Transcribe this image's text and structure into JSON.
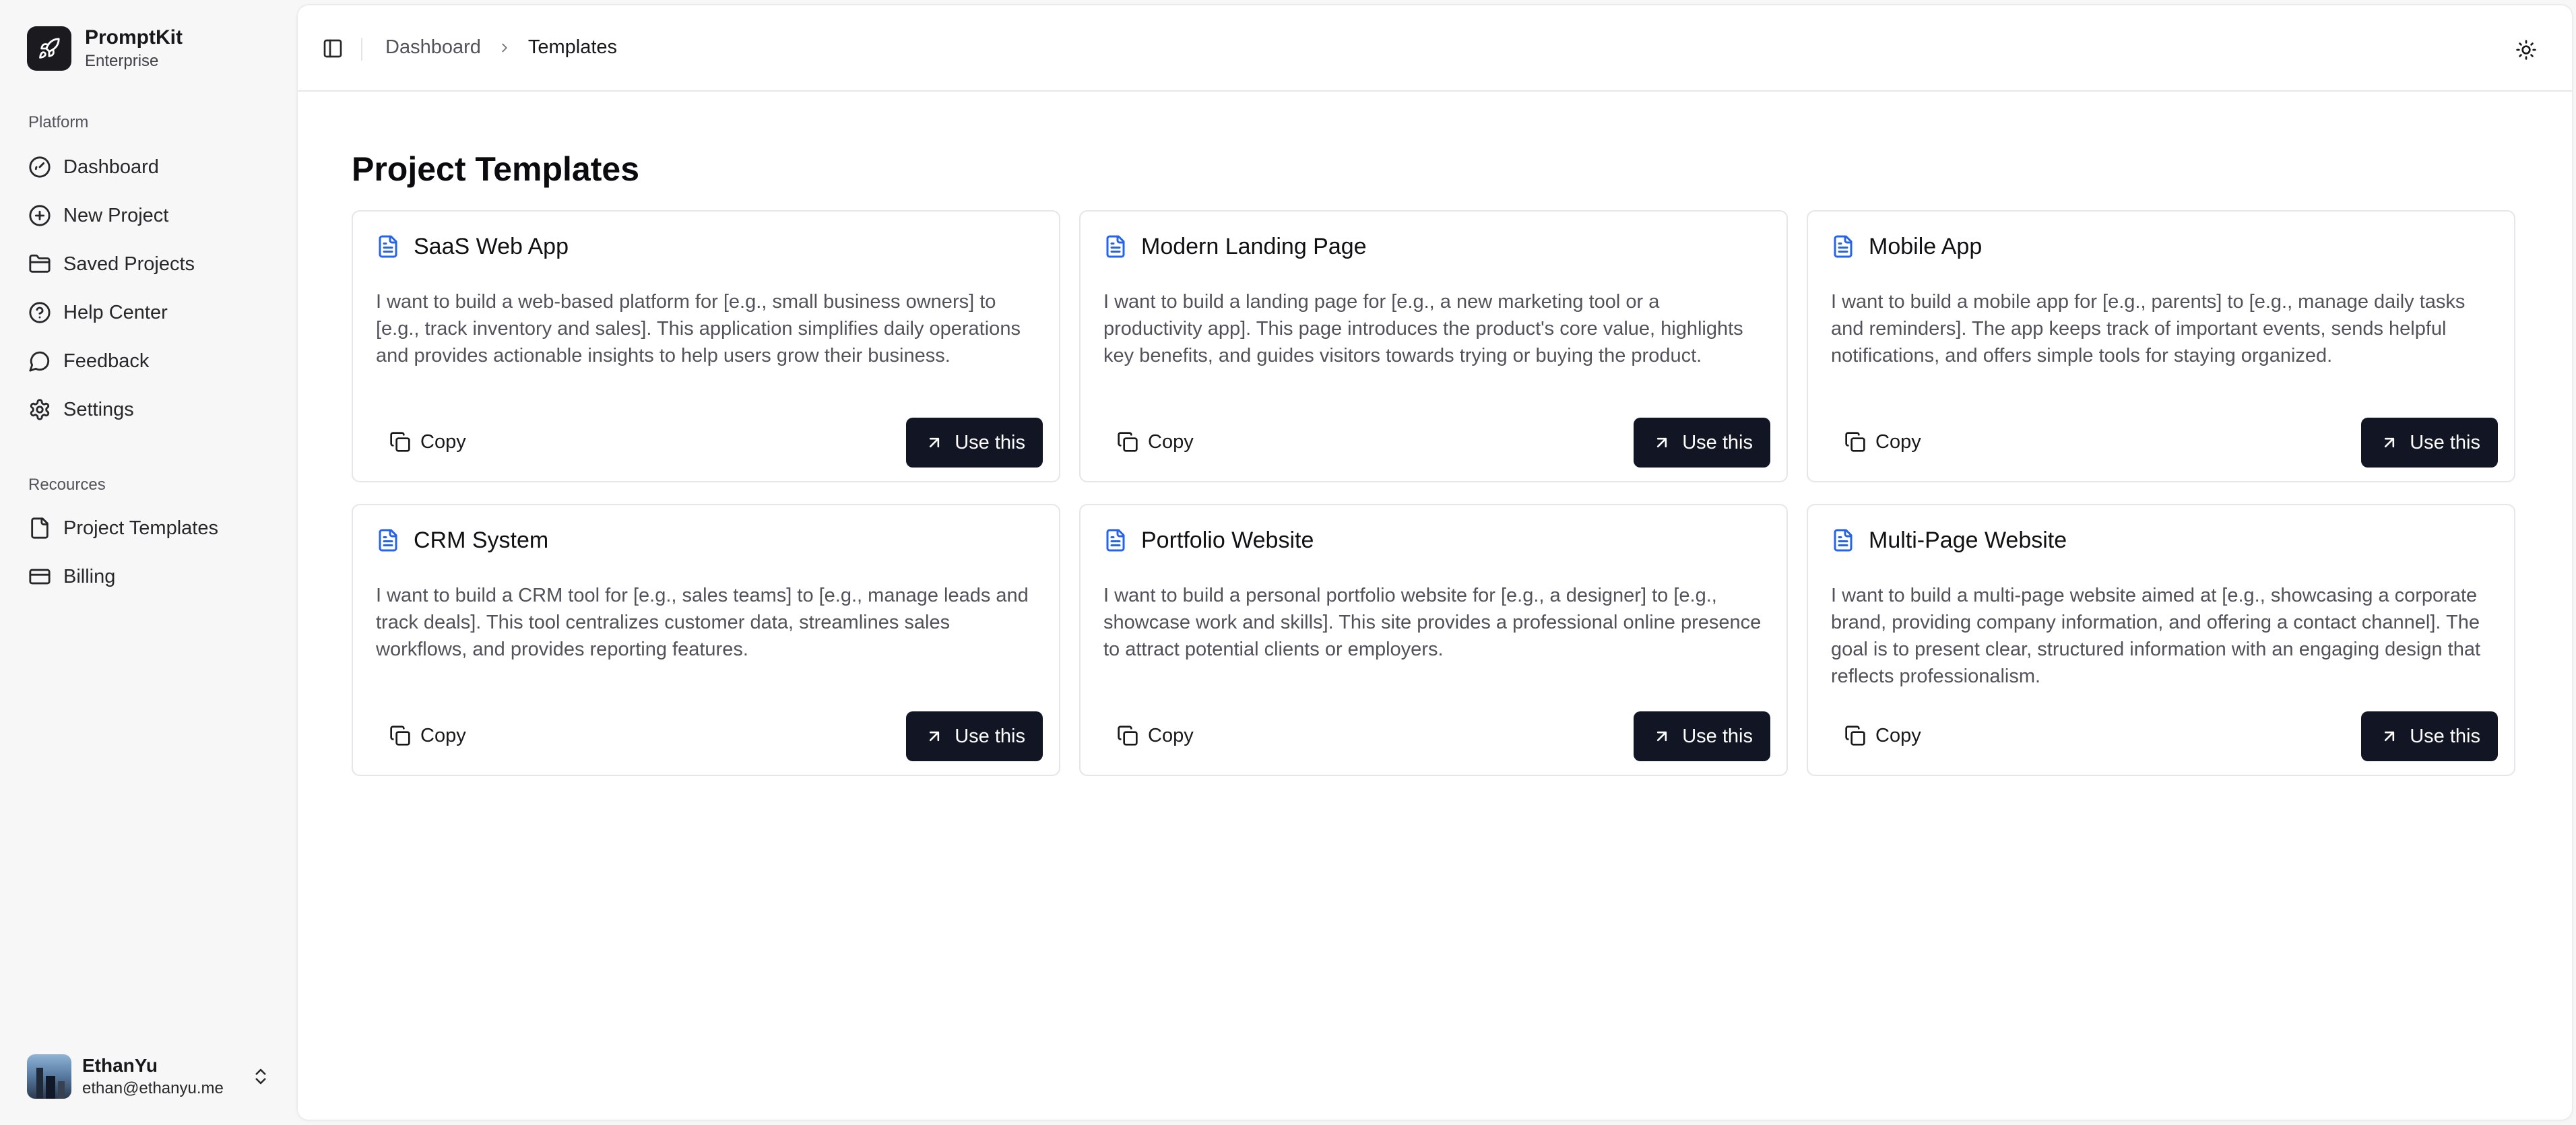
{
  "brand": {
    "name": "PromptKit",
    "plan": "Enterprise"
  },
  "sidebar": {
    "platform_label": "Platform",
    "platform_items": [
      {
        "label": "Dashboard",
        "icon": "gauge-icon"
      },
      {
        "label": "New Project",
        "icon": "plus-circle-icon"
      },
      {
        "label": "Saved Projects",
        "icon": "folder-icon"
      },
      {
        "label": "Help Center",
        "icon": "help-circle-icon"
      },
      {
        "label": "Feedback",
        "icon": "message-circle-icon"
      },
      {
        "label": "Settings",
        "icon": "gear-icon"
      }
    ],
    "resources_label": "Recources",
    "resource_items": [
      {
        "label": "Project Templates",
        "icon": "file-icon"
      },
      {
        "label": "Billing",
        "icon": "credit-card-icon"
      }
    ]
  },
  "user": {
    "name": "EthanYu",
    "email": "ethan@ethanyu.me"
  },
  "header": {
    "breadcrumb": {
      "parent": "Dashboard",
      "current": "Templates"
    }
  },
  "main": {
    "title": "Project Templates",
    "copy_label": "Copy",
    "use_label": "Use this",
    "templates": [
      {
        "title": "SaaS Web App",
        "description": "I want to build a web-based platform for [e.g., small business owners] to [e.g., track inventory and sales]. This application simplifies daily operations and provides actionable insights to help users grow their business."
      },
      {
        "title": "Modern Landing Page",
        "description": "I want to build a landing page for [e.g., a new marketing tool or a productivity app]. This page introduces the product's core value, highlights key benefits, and guides visitors towards trying or buying the product."
      },
      {
        "title": "Mobile App",
        "description": "I want to build a mobile app for [e.g., parents] to [e.g., manage daily tasks and reminders]. The app keeps track of important events, sends helpful notifications, and offers simple tools for staying organized."
      },
      {
        "title": "CRM System",
        "description": "I want to build a CRM tool for [e.g., sales teams] to [e.g., manage leads and track deals]. This tool centralizes customer data, streamlines sales workflows, and provides reporting features."
      },
      {
        "title": "Portfolio Website",
        "description": "I want to build a personal portfolio website for [e.g., a designer] to [e.g., showcase work and skills]. This site provides a professional online presence to attract potential clients or employers."
      },
      {
        "title": "Multi-Page Website",
        "description": "I want to build a multi-page website aimed at [e.g., showcasing a corporate brand, providing company information, and offering a contact channel]. The goal is to present clear, structured information with an engaging design that reflects professionalism."
      }
    ]
  },
  "colors": {
    "accent_icon": "#2563eb",
    "primary_button": "#121624",
    "sidebar_bg": "#f7f7f8"
  }
}
